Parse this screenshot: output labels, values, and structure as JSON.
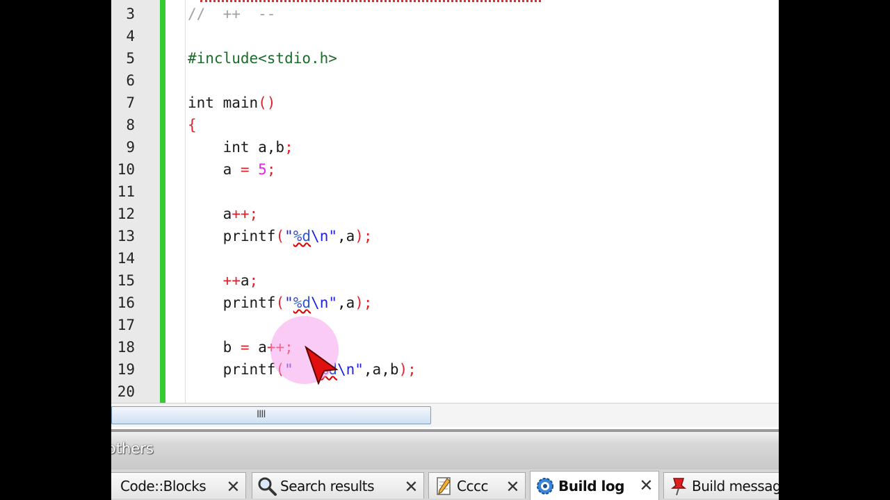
{
  "editor": {
    "lines": [
      {
        "num": "3",
        "tokens": [
          {
            "t": "//  ++  --",
            "c": "cm"
          }
        ]
      },
      {
        "num": "4",
        "tokens": []
      },
      {
        "num": "5",
        "tokens": [
          {
            "t": "#include<stdio.h>",
            "c": "pp"
          }
        ]
      },
      {
        "num": "6",
        "tokens": []
      },
      {
        "num": "7",
        "tokens": [
          {
            "t": "int main",
            "c": "kw"
          },
          {
            "t": "()",
            "c": "op"
          }
        ]
      },
      {
        "num": "8",
        "tokens": [
          {
            "t": "{",
            "c": "op"
          }
        ]
      },
      {
        "num": "9",
        "tokens": [
          {
            "t": "    int a,b",
            "c": "kw"
          },
          {
            "t": ";",
            "c": "op"
          }
        ]
      },
      {
        "num": "10",
        "tokens": [
          {
            "t": "    a ",
            "c": "kw"
          },
          {
            "t": "=",
            "c": "op"
          },
          {
            "t": " ",
            "c": "kw"
          },
          {
            "t": "5",
            "c": "num"
          },
          {
            "t": ";",
            "c": "op"
          }
        ]
      },
      {
        "num": "11",
        "tokens": []
      },
      {
        "num": "12",
        "tokens": [
          {
            "t": "    a",
            "c": "kw"
          },
          {
            "t": "++;",
            "c": "op"
          }
        ]
      },
      {
        "num": "13",
        "tokens": [
          {
            "t": "    printf",
            "c": "kw"
          },
          {
            "t": "(",
            "c": "op"
          },
          {
            "t": "\"",
            "c": "str"
          },
          {
            "t": "%d",
            "c": "fmt"
          },
          {
            "t": "\\n\"",
            "c": "str"
          },
          {
            "t": ",a",
            "c": "kw"
          },
          {
            "t": ");",
            "c": "op"
          }
        ]
      },
      {
        "num": "14",
        "tokens": []
      },
      {
        "num": "15",
        "tokens": [
          {
            "t": "    ",
            "c": "kw"
          },
          {
            "t": "++",
            "c": "op"
          },
          {
            "t": "a",
            "c": "kw"
          },
          {
            "t": ";",
            "c": "op"
          }
        ]
      },
      {
        "num": "16",
        "tokens": [
          {
            "t": "    printf",
            "c": "kw"
          },
          {
            "t": "(",
            "c": "op"
          },
          {
            "t": "\"",
            "c": "str"
          },
          {
            "t": "%d",
            "c": "fmt"
          },
          {
            "t": "\\n\"",
            "c": "str"
          },
          {
            "t": ",a",
            "c": "kw"
          },
          {
            "t": ");",
            "c": "op"
          }
        ]
      },
      {
        "num": "17",
        "tokens": []
      },
      {
        "num": "18",
        "tokens": [
          {
            "t": "    b ",
            "c": "kw"
          },
          {
            "t": "=",
            "c": "op"
          },
          {
            "t": " a",
            "c": "kw"
          },
          {
            "t": "++;",
            "c": "op"
          }
        ]
      },
      {
        "num": "19",
        "tokens": [
          {
            "t": "    printf",
            "c": "kw"
          },
          {
            "t": "(",
            "c": "op"
          },
          {
            "t": "\"   ",
            "c": "str"
          },
          {
            "t": "%d",
            "c": "fmt"
          },
          {
            "t": "\\n\"",
            "c": "str"
          },
          {
            "t": ",a,b",
            "c": "kw"
          },
          {
            "t": ");",
            "c": "op"
          }
        ]
      },
      {
        "num": "20",
        "tokens": []
      }
    ]
  },
  "scrollbar": {
    "grip": "IIII"
  },
  "panel": {
    "title": "others"
  },
  "tabs": [
    {
      "label": "Code::Blocks",
      "icon": "codeblocks-icon",
      "close": "✕",
      "active": false
    },
    {
      "label": "Search results",
      "icon": "search-icon",
      "close": "✕",
      "active": false
    },
    {
      "label": "Cccc",
      "icon": "pencil-document-icon",
      "close": "✕",
      "active": false
    },
    {
      "label": "Build log",
      "icon": "gear-icon",
      "close": "✕",
      "active": true
    },
    {
      "label": "Build message",
      "icon": "pin-icon",
      "close": "",
      "active": false
    }
  ],
  "colors": {
    "change_bar": "#33cc33",
    "operator": "#e0202a",
    "preprocessor": "#1b6b2a",
    "string": "#2020dd",
    "number": "#ee22ee"
  }
}
